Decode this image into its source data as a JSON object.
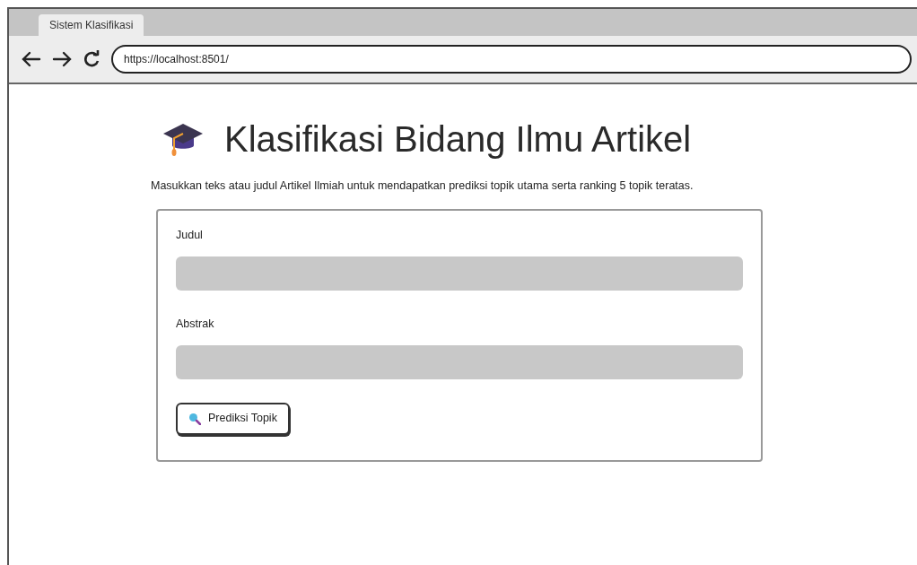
{
  "browser": {
    "tab": {
      "label": "Sistem Klasifikasi",
      "selected": true
    },
    "url": "https://localhost:8501/"
  },
  "page": {
    "title": "Klasifikasi Bidang Ilmu Artikel",
    "description": "Masukkan teks atau judul Artikel Ilmiah untuk mendapatkan prediksi topik utama serta ranking 5 topik teratas.",
    "form": {
      "fields": [
        {
          "label": "Judul"
        },
        {
          "label": "Abstrak"
        }
      ],
      "button": {
        "label": "Prediksi Topik"
      }
    }
  }
}
